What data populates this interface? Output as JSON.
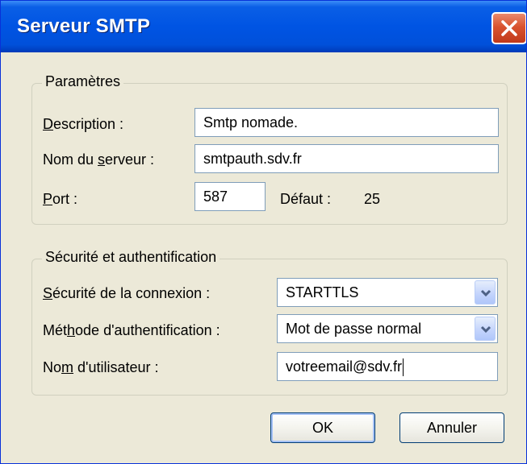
{
  "window": {
    "title": "Serveur SMTP",
    "colors": {
      "titlebar": "#0054e3",
      "dialog_bg": "#ece9d8",
      "close_button": "#d9532f"
    }
  },
  "settings": {
    "legend": "Paramètres",
    "description": {
      "label_before": "",
      "label_underline": "D",
      "label_after": "escription :",
      "value": "Smtp nomade."
    },
    "server": {
      "label_before": "Nom du ",
      "label_underline": "s",
      "label_after": "erveur :",
      "value": "smtpauth.sdv.fr"
    },
    "port": {
      "label_before": "",
      "label_underline": "P",
      "label_after": "ort :",
      "value": "587",
      "default_label": "Défaut :",
      "default_value": "25"
    }
  },
  "security": {
    "legend": "Sécurité et authentification",
    "connection": {
      "label_before": "",
      "label_underline": "S",
      "label_after": "écurité de la connexion :",
      "value": "STARTTLS"
    },
    "auth_method": {
      "label_before": "Mét",
      "label_underline": "h",
      "label_after": "ode d'authentification :",
      "value": "Mot de passe normal"
    },
    "username": {
      "label_before": "No",
      "label_underline": "m",
      "label_after": " d'utilisateur :",
      "value": "votreemail@sdv.fr"
    }
  },
  "buttons": {
    "ok": "OK",
    "cancel": "Annuler"
  },
  "icons": {
    "close": "close-icon",
    "dropdown": "chevron-down-icon"
  }
}
